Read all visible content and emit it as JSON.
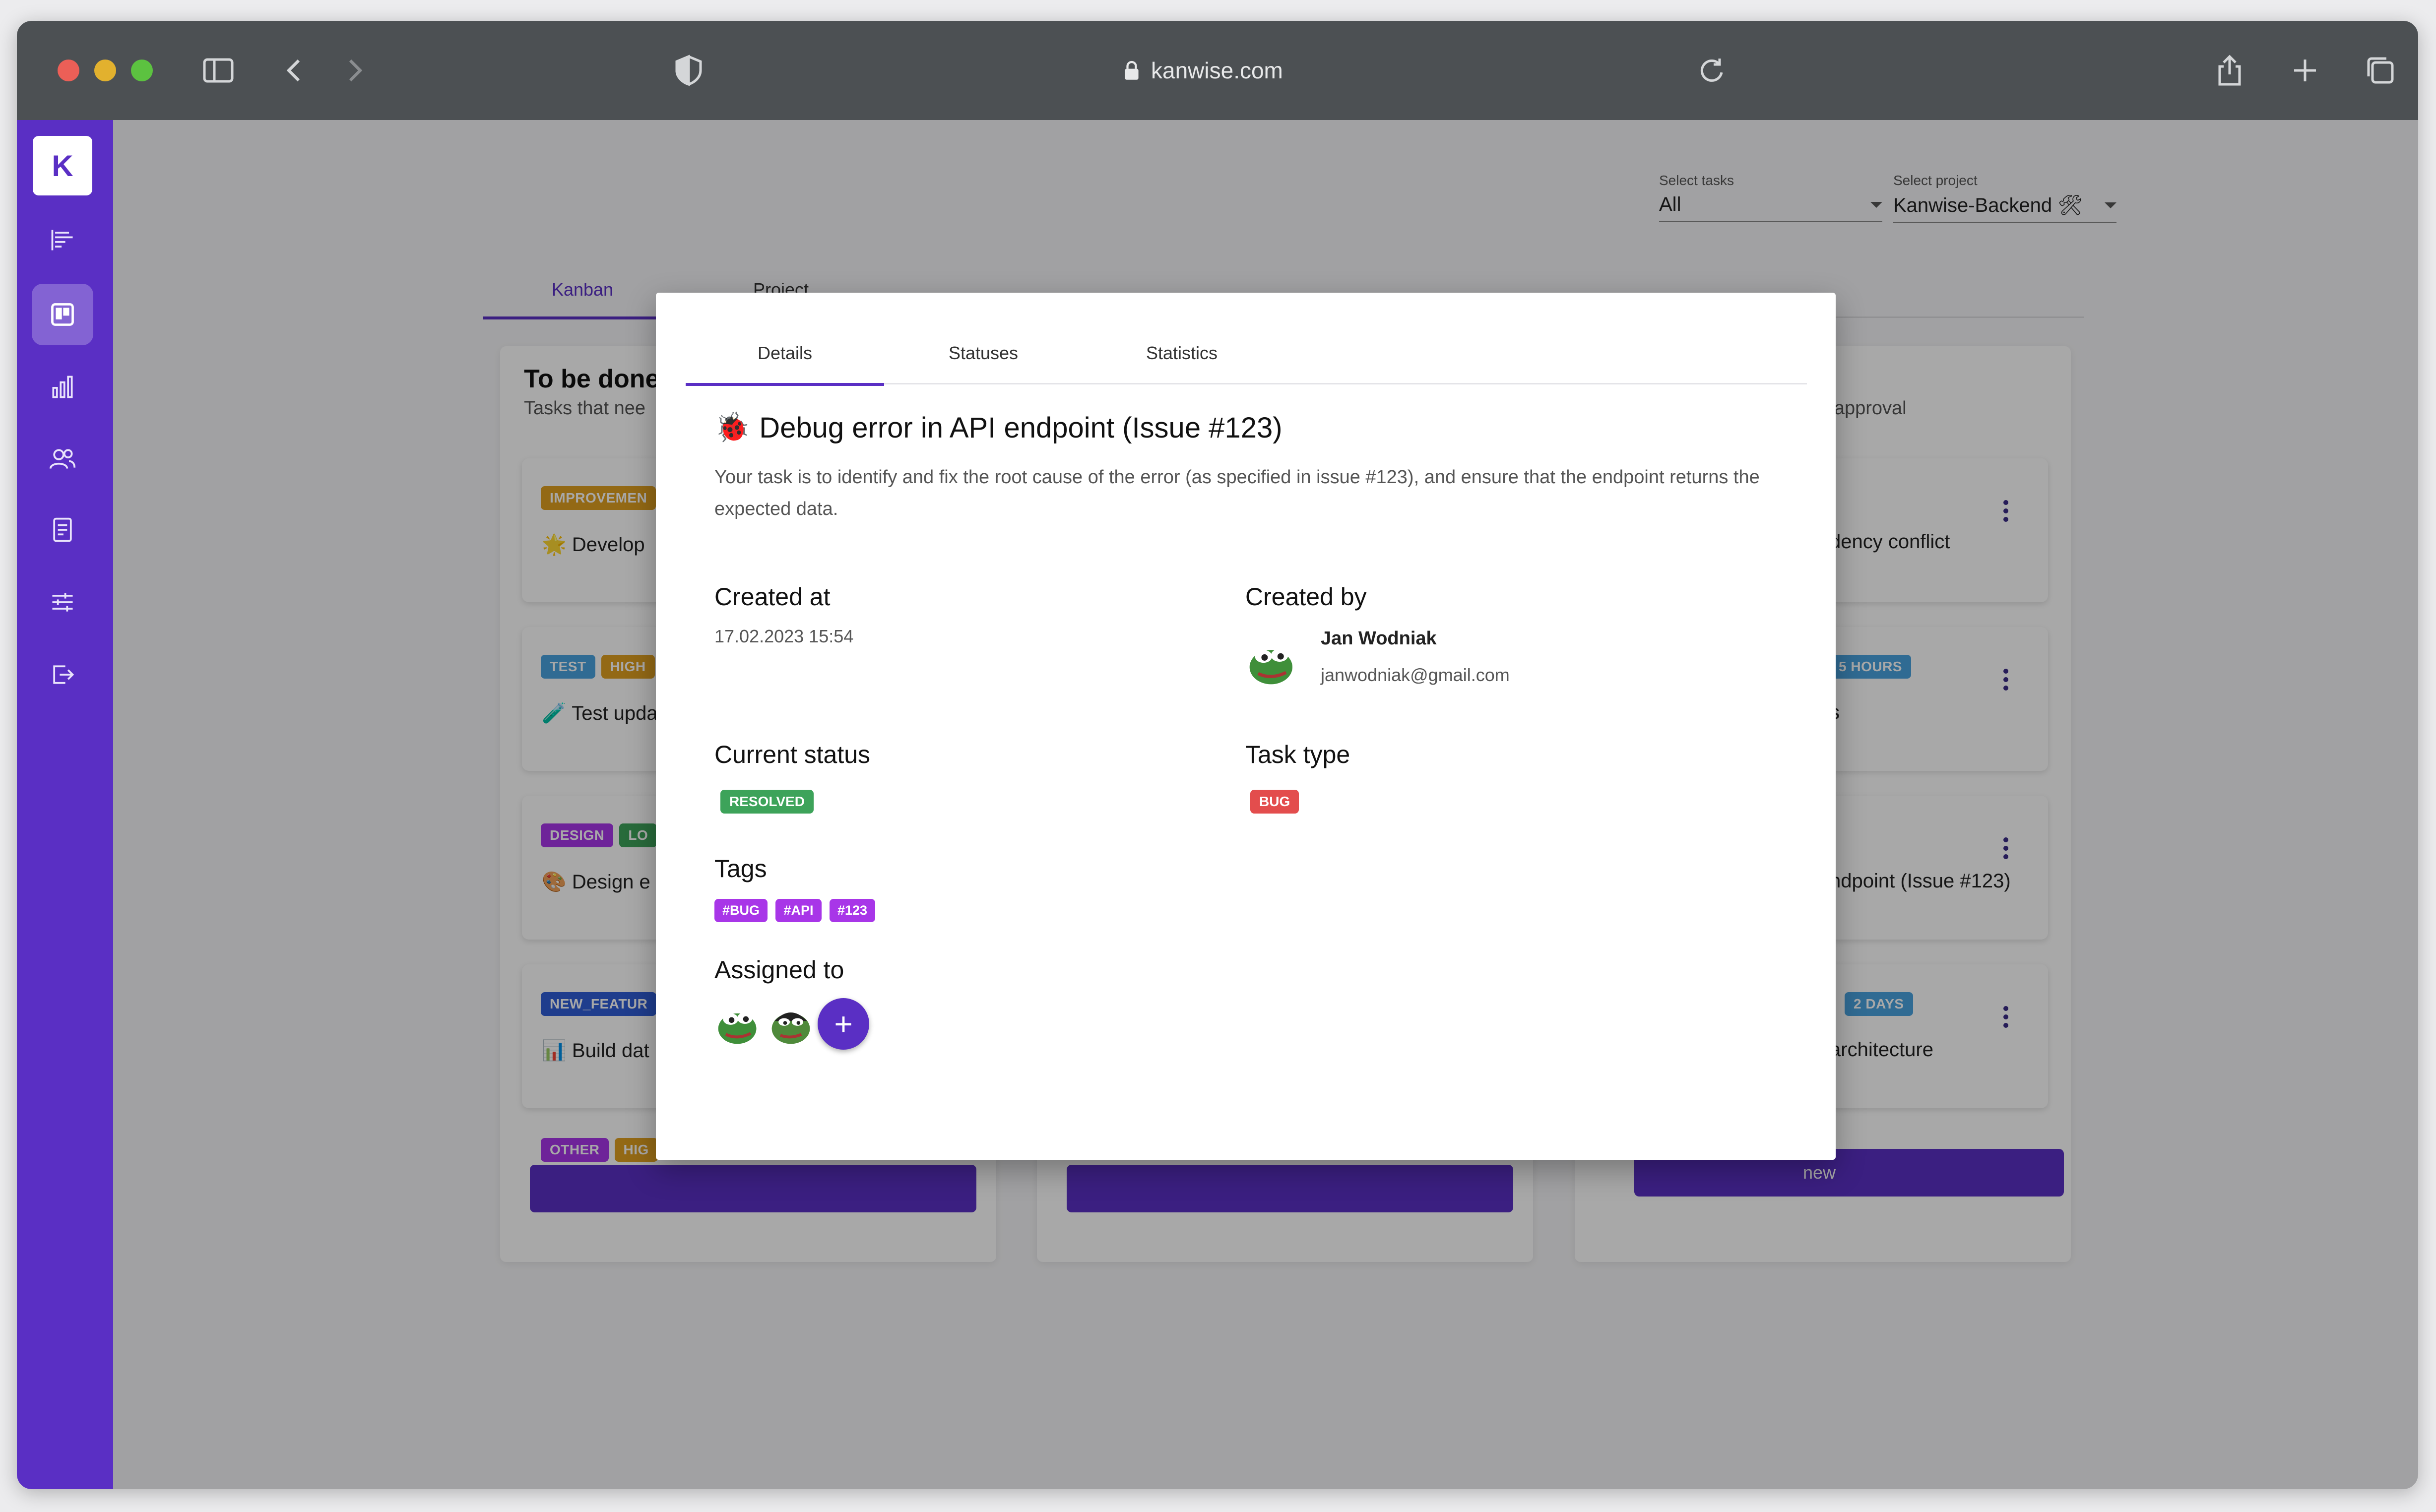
{
  "browser": {
    "url": "kanwise.com"
  },
  "app": {
    "logo_letter": "K",
    "filters": {
      "tasks_label": "Select tasks",
      "tasks_value": "All",
      "project_label": "Select project",
      "project_value": "Kanwise-Backend 🛠"
    },
    "tabs": [
      "Kanban",
      "Project"
    ],
    "columns": [
      {
        "title": "To be done",
        "subtitle": "Tasks that nee",
        "cards": [
          {
            "chips": [
              {
                "text": "IMPROVEMEN",
                "color": "#e0a020"
              }
            ],
            "text": "🌟 Develop"
          },
          {
            "chips": [
              {
                "text": "TEST",
                "color": "#4aa3df"
              },
              {
                "text": "HIGH",
                "color": "#e0a020"
              }
            ],
            "text": "🧪 Test upda"
          },
          {
            "chips": [
              {
                "text": "DESIGN",
                "color": "#a836e8"
              },
              {
                "text": "LO",
                "color": "#3da35a"
              }
            ],
            "text": "🎨 Design e"
          },
          {
            "chips": [
              {
                "text": "NEW_FEATUR",
                "color": "#2f5dd6"
              }
            ],
            "text": "📊 Build dat"
          },
          {
            "chips": [
              {
                "text": "OTHER",
                "color": "#a836e8"
              },
              {
                "text": "HIG",
                "color": "#e0a020"
              }
            ],
            "text": ""
          }
        ]
      },
      {
        "title": "",
        "subtitle": "",
        "cards": []
      },
      {
        "title": "",
        "subtitle": "ng approval",
        "cards": [
          {
            "chips": [],
            "text": "dency conflict"
          },
          {
            "chips": [
              {
                "text": "5 HOURS",
                "color": "#4aa3df"
              }
            ],
            "text": "s"
          },
          {
            "chips": [],
            "text": "ndpoint (Issue #123)"
          },
          {
            "chips": [
              {
                "text": "2 DAYS",
                "color": "#4aa3df"
              }
            ],
            "text": "architecture"
          }
        ],
        "add_label": "new"
      }
    ]
  },
  "modal": {
    "tabs": [
      "Details",
      "Statuses",
      "Statistics"
    ],
    "title_icon": "🐞",
    "title": "Debug error in API endpoint (Issue #123)",
    "description": "Your task is to identify and fix the root cause of the error (as specified in issue #123), and ensure that the endpoint returns the expected data.",
    "created_at_label": "Created at",
    "created_at_value": "17.02.2023 15:54",
    "created_by_label": "Created by",
    "creator_name": "Jan Wodniak",
    "creator_email": "janwodniak@gmail.com",
    "status_label": "Current status",
    "status_value": "RESOLVED",
    "status_color": "#3da35a",
    "type_label": "Task type",
    "type_value": "BUG",
    "type_color": "#e34d4d",
    "tags_label": "Tags",
    "tags": [
      "#BUG",
      "#API",
      "#123"
    ],
    "assigned_label": "Assigned to",
    "add_assignee": "+"
  },
  "colors": {
    "brand": "#5a2fc4",
    "tag": "#a836e8"
  }
}
